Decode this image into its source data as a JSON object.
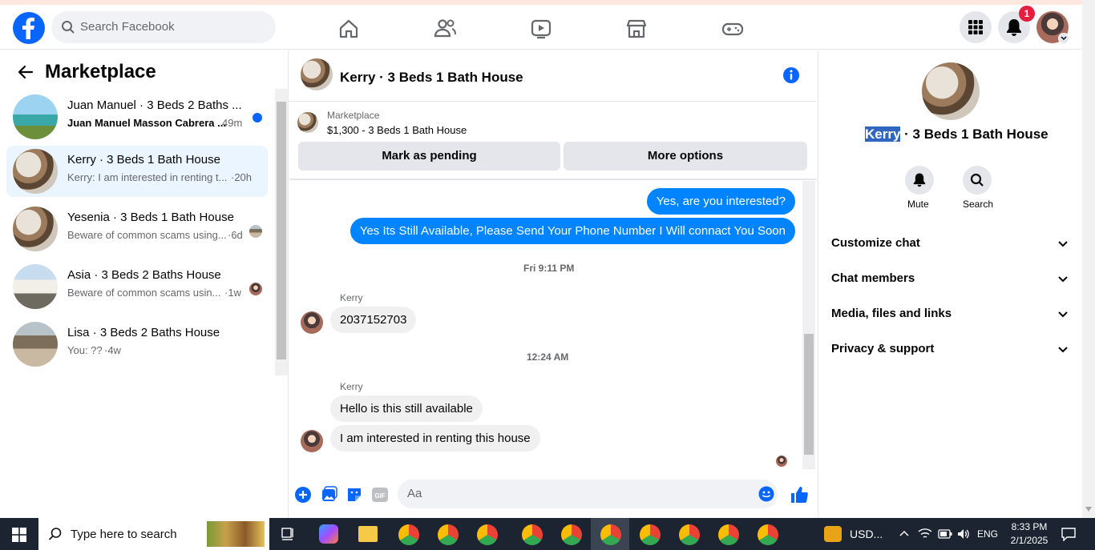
{
  "topbar": {
    "search_placeholder": "Search Facebook",
    "notification_count": "1",
    "nav_icons": [
      "home-icon",
      "friends-icon",
      "video-icon",
      "marketplace-icon",
      "gaming-icon"
    ]
  },
  "left": {
    "title": "Marketplace",
    "conversations": [
      {
        "title": "Juan Manuel · 3 Beds 2 Baths ...",
        "preview": "Juan Manuel Masson Cabrera ...",
        "time": "49m",
        "unread": true
      },
      {
        "title": "Kerry · 3 Beds 1 Bath House",
        "preview": "Kerry: I am interested in renting t...",
        "time": "·20h",
        "selected": true
      },
      {
        "title": "Yesenia · 3 Beds 1 Bath House",
        "preview": "Beware of common scams using...",
        "time": "·6d"
      },
      {
        "title": "Asia · 3 Beds 2 Baths House",
        "preview": "Beware of common scams usin...",
        "time": "·1w"
      },
      {
        "title": "Lisa · 3 Beds 2 Baths House",
        "preview": "You: ??",
        "time": "·4w"
      }
    ]
  },
  "chat": {
    "header_title": "Kerry · 3 Beds 1 Bath House",
    "listing_source": "Marketplace",
    "listing_price_title": "$1,300 - 3 Beds 1 Bath House",
    "mark_pending": "Mark as pending",
    "more_options": "More options",
    "messages": {
      "sent1": "Yes, are you interested?",
      "sent2": "Yes Its Still Available, Please Send Your Phone Number I Will connact You Soon",
      "ts1": "Fri 9:11 PM",
      "sender1": "Kerry",
      "recv1": "2037152703",
      "ts2": "12:24 AM",
      "sender2": "Kerry",
      "recv2": "Hello is this still available",
      "recv3": "I am interested in renting this house"
    },
    "composer_placeholder": "Aa"
  },
  "right": {
    "name_highlight": "Kerry",
    "name_rest": " · 3 Beds 1 Bath House",
    "mute": "Mute",
    "search": "Search",
    "sections": [
      "Customize chat",
      "Chat members",
      "Media, files and links",
      "Privacy & support"
    ]
  },
  "taskbar": {
    "search_placeholder": "Type here to search",
    "currency": "USD...",
    "lang": "ENG",
    "time": "8:33 PM",
    "date": "2/1/2025"
  },
  "colors": {
    "brand": "#0866ff",
    "bubble_sent": "#0084ff",
    "selected_row": "#ebf5ff",
    "badge": "#e41e3f"
  }
}
